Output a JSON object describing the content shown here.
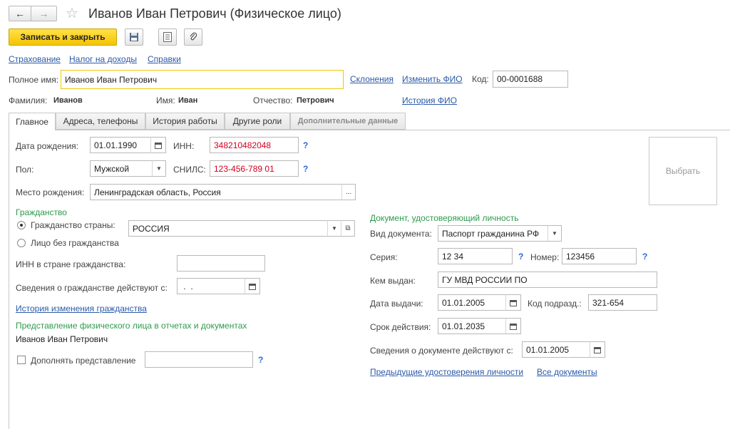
{
  "window": {
    "title": "Иванов Иван Петрович (Физическое лицо)"
  },
  "toolbar": {
    "save_close": "Записать и закрыть"
  },
  "top_links": [
    "Страхование",
    "Налог на доходы",
    "Справки"
  ],
  "name": {
    "full_label": "Полное имя:",
    "full_value": "Иванов Иван Петрович",
    "declensions": "Склонения",
    "change": "Изменить ФИО",
    "code_label": "Код:",
    "code_value": "00-0001688",
    "last_label": "Фамилия:",
    "last_value": "Иванов",
    "first_label": "Имя:",
    "first_value": "Иван",
    "middle_label": "Отчество:",
    "middle_value": "Петрович",
    "history": "История ФИО"
  },
  "tabs": [
    "Главное",
    "Адреса, телефоны",
    "История работы",
    "Другие роли",
    "Дополнительные данные"
  ],
  "main": {
    "birth_label": "Дата рождения:",
    "birth_value": "01.01.1990",
    "inn_label": "ИНН:",
    "inn_value": "348210482048",
    "sex_label": "Пол:",
    "sex_value": "Мужской",
    "snils_label": "СНИЛС:",
    "snils_value": "123-456-789 01",
    "birthplace_label": "Место рождения:",
    "birthplace_value": "Ленинградская область, Россия",
    "photo_button": "Выбрать",
    "question": "?"
  },
  "citizenship": {
    "title": "Гражданство",
    "country_label": "Гражданство страны:",
    "country_value": "РОССИЯ",
    "stateless_label": "Лицо без гражданства",
    "inn_foreign_label": "ИНН в стране гражданства:",
    "valid_from_label": "Сведения о гражданстве действуют с:",
    "valid_from_value": " .  .",
    "history_link": "История изменения гражданства"
  },
  "representation": {
    "title": "Представление физического лица в отчетах и документах",
    "value": "Иванов Иван Петрович",
    "supplement_label": "Дополнять представление"
  },
  "document": {
    "title": "Документ, удостоверяющий личность",
    "type_label": "Вид документа:",
    "type_value": "Паспорт гражданина РФ",
    "series_label": "Серия:",
    "series_value": "12 34",
    "number_label": "Номер:",
    "number_value": "123456",
    "issued_by_label": "Кем выдан:",
    "issued_by_value": "ГУ МВД РОССИИ ПО",
    "issue_date_label": "Дата выдачи:",
    "issue_date_value": "01.01.2005",
    "dept_code_label": "Код подразд.:",
    "dept_code_value": "321-654",
    "valid_until_label": "Срок действия:",
    "valid_until_value": "01.01.2035",
    "info_from_label": "Сведения о документе действуют с:",
    "info_from_value": "01.01.2005",
    "prev_docs_link": "Предыдущие удостоверения личности",
    "all_docs_link": "Все документы"
  },
  "colors": {
    "accent_yellow": "#f5c400",
    "link": "#2a5aa8",
    "section_green": "#2e9a4e",
    "invalid_red": "#d2001f"
  }
}
